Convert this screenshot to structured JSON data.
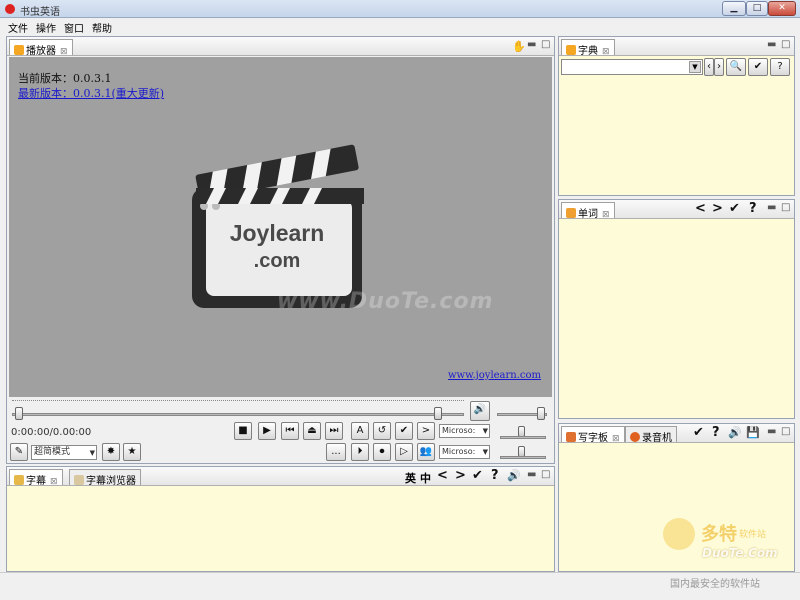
{
  "window": {
    "title": "书虫英语"
  },
  "menu": [
    "文件",
    "操作",
    "窗口",
    "帮助"
  ],
  "player": {
    "tab_label": "播放器",
    "version_current": "当前版本：0.0.3.1",
    "version_latest_label": "最新版本：",
    "version_latest_value": "0.0.3.1(重大更新)",
    "logo_line1": "Joylearn",
    "logo_line2": ".com",
    "watermark": "www.DuoTe.com",
    "site_link": "www.joylearn.com",
    "time": "0:00:00/0.00:00",
    "mode": "超简模式",
    "voice_1": "Microso:",
    "voice_2": "Microso:",
    "dots_label": "...",
    "letter_a": "A"
  },
  "subtitle_panel": {
    "tab_subtitles": "字幕",
    "tab_browser": "字幕浏览器",
    "lang_en": "英",
    "lang_zh": "中"
  },
  "dictionary": {
    "tab_label": "字典"
  },
  "words": {
    "tab_label": "单词"
  },
  "writing": {
    "tab_label": "写字板",
    "recorder_tab": "录音机"
  },
  "watermark_site": {
    "brand": "多特",
    "brand_sub": "软件站",
    "domain": "DuoTe.Com",
    "slogan": "国内最安全的软件站"
  },
  "colors": {
    "panel_bg": "#fefcd8",
    "video_bg": "#a0a0a0",
    "link": "#1a1acc"
  }
}
